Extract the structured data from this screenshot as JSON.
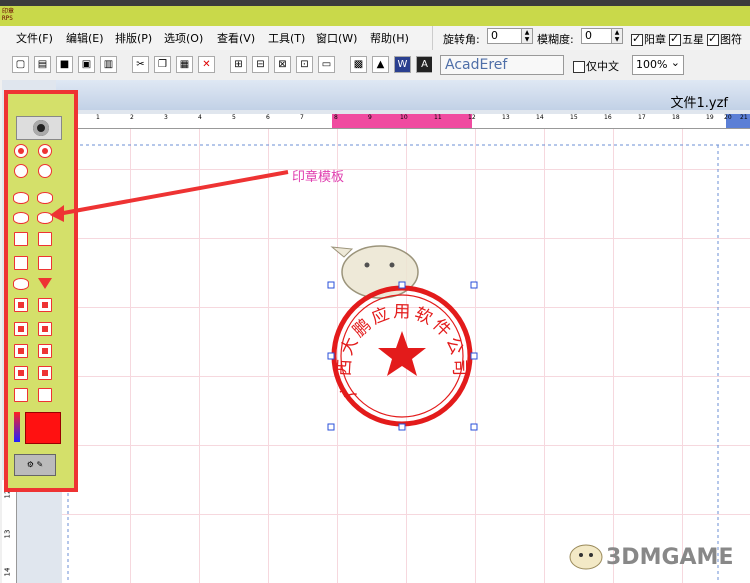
{
  "app_icon_text": "印章\nRPS",
  "menu": [
    "文件(F)",
    "编辑(E)",
    "排版(P)",
    "选项(O)",
    "查看(V)",
    "工具(T)",
    "窗口(W)",
    "帮助(H)"
  ],
  "options": {
    "rotate_label": "旋转角:",
    "rotate_value": "0",
    "blur_label": "模糊度:",
    "blur_value": "0",
    "yinzhang_label": "阳章",
    "wuxing_label": "五星",
    "tufu_label": "图符"
  },
  "font": {
    "name": "AcadEref",
    "only_chinese_label": "仅中文",
    "zoom": "100%"
  },
  "document": {
    "title": "文件1.yzf"
  },
  "ruler_labels": [
    "1",
    "2",
    "3",
    "4",
    "5",
    "6",
    "7",
    "8",
    "9",
    "10",
    "11",
    "12",
    "13",
    "14",
    "15",
    "16",
    "17",
    "18",
    "19",
    "20",
    "21"
  ],
  "vruler_labels": [
    "12",
    "13",
    "14"
  ],
  "annotation": "印章模板",
  "seal": {
    "text": "广西大鹏应用软件公司",
    "color": "#e31b1b"
  },
  "watermark": "3DMGAME",
  "colors": {
    "accent_red": "#ee3333",
    "palette_bg": "#d4e06a",
    "title_bar": "#c9d94a",
    "ruler_highlight": "#f04ba0"
  }
}
